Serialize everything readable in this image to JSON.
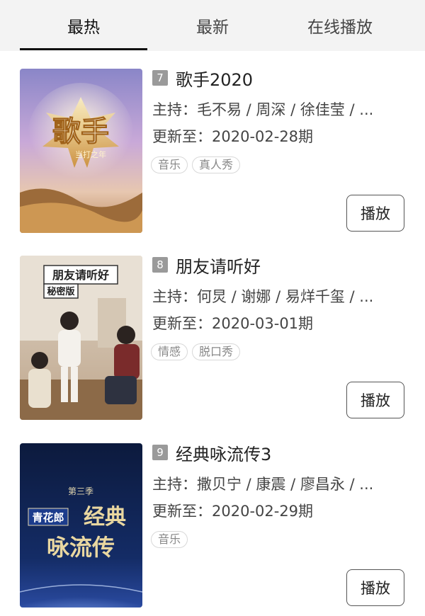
{
  "tabs": [
    {
      "label": "最热",
      "active": true
    },
    {
      "label": "最新",
      "active": false
    },
    {
      "label": "在线播放",
      "active": false
    }
  ],
  "items": [
    {
      "rank": "7",
      "title": "歌手2020",
      "hosts": "主持：毛不易 / 周深 / 徐佳莹 / ...",
      "update": "更新至：2020-02-28期",
      "tags": [
        "音乐",
        "真人秀"
      ],
      "play_label": "播放",
      "poster_text": "歌手",
      "poster_subtitle": "当打之年"
    },
    {
      "rank": "8",
      "title": "朋友请听好",
      "hosts": "主持：何炅 / 谢娜 / 易烊千玺 / ...",
      "update": "更新至：2020-03-01期",
      "tags": [
        "情感",
        "脱口秀"
      ],
      "play_label": "播放",
      "poster_text": "朋友请听好",
      "poster_subtitle": "秘密版"
    },
    {
      "rank": "9",
      "title": "经典咏流传3",
      "hosts": "主持：撒贝宁 / 康震 / 廖昌永 / ...",
      "update": "更新至：2020-02-29期",
      "tags": [
        "音乐"
      ],
      "play_label": "播放",
      "poster_season": "第三季",
      "poster_brand": "青花郎",
      "poster_text_1": "经典",
      "poster_text_2": "咏流传"
    }
  ],
  "colors": {
    "tab_bg": "#f3f3f3",
    "badge_bg": "#9a9a9a",
    "tag_border": "#d8d8d8",
    "button_border": "#555555"
  }
}
